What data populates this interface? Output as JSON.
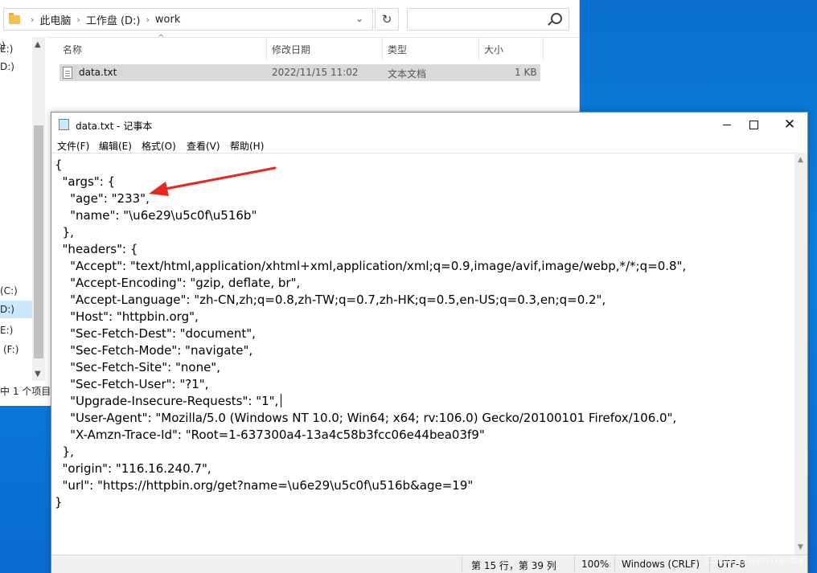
{
  "explorer": {
    "breadcrumb": [
      "此电脑",
      "工作盘 (D:)",
      "work"
    ],
    "columns": [
      "名称",
      "修改日期",
      "类型",
      "大小"
    ],
    "file": {
      "name": "data.txt",
      "date": "2022/11/15 11:02",
      "type": "文本文档",
      "size": "1 KB"
    },
    "nav_items": [
      ":)",
      "E:)",
      "D:)",
      "(C:)",
      "D:)",
      "E:)",
      "(F:)"
    ],
    "status": "中 1 个项目"
  },
  "notepad": {
    "title": "data.txt - 记事本",
    "menu": [
      "文件(F)",
      "编辑(E)",
      "格式(O)",
      "查看(V)",
      "帮助(H)"
    ],
    "lines": [
      "{",
      "  \"args\": {",
      "    \"age\": \"233\",",
      "    \"name\": \"\\u6e29\\u5c0f\\u516b\"",
      "  },",
      "  \"headers\": {",
      "    \"Accept\": \"text/html,application/xhtml+xml,application/xml;q=0.9,image/avif,image/webp,*/*;q=0.8\",",
      "    \"Accept-Encoding\": \"gzip, deflate, br\",",
      "    \"Accept-Language\": \"zh-CN,zh;q=0.8,zh-TW;q=0.7,zh-HK;q=0.5,en-US;q=0.3,en;q=0.2\",",
      "    \"Host\": \"httpbin.org\",",
      "    \"Sec-Fetch-Dest\": \"document\",",
      "    \"Sec-Fetch-Mode\": \"navigate\",",
      "    \"Sec-Fetch-Site\": \"none\",",
      "    \"Sec-Fetch-User\": \"?1\",",
      "    \"Upgrade-Insecure-Requests\": \"1\",",
      "    \"User-Agent\": \"Mozilla/5.0 (Windows NT 10.0; Win64; x64; rv:106.0) Gecko/20100101 Firefox/106.0\",",
      "    \"X-Amzn-Trace-Id\": \"Root=1-637300a4-13a4c58b3fcc06e44bea03f9\"",
      "  },",
      "  \"origin\": \"116.16.240.7\",",
      "  \"url\": \"https://httpbin.org/get?name=\\u6e29\\u5c0f\\u516b&age=19\"",
      "}"
    ],
    "caret_line": 15,
    "status": {
      "position": "第 15 行，第 39 列",
      "zoom": "100%",
      "line_ending": "Windows (CRLF)",
      "encoding": "UTF-8"
    }
  },
  "watermark": "CSDN @wenxiaoba",
  "colors": {
    "annotation_arrow": "#e8281e",
    "desktop": "#0a76d6",
    "selection": "#d9d9d9"
  },
  "icons": [
    "folder-icon",
    "refresh-icon",
    "search-icon",
    "file-icon",
    "notepad-icon",
    "minimize-icon",
    "maximize-icon",
    "close-icon"
  ]
}
